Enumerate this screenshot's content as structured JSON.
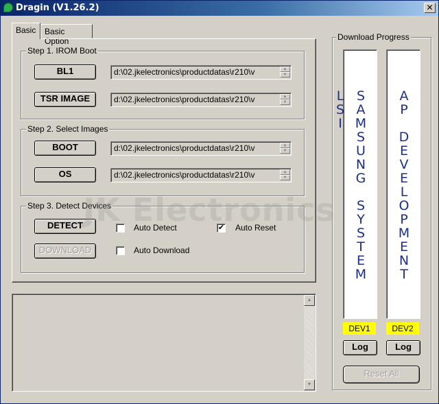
{
  "window": {
    "title": "Dragin (V1.26.2)",
    "close_glyph": "✕"
  },
  "tabs": [
    {
      "label": "Basic"
    },
    {
      "label": "Basic Option"
    }
  ],
  "step1": {
    "label": "Step 1. IROM Boot",
    "bl1_button": "BL1",
    "bl1_path": "d:\\02.jkelectronics\\productdatas\\r210\\v",
    "tsr_button": "TSR IMAGE",
    "tsr_path": "d:\\02.jkelectronics\\productdatas\\r210\\v"
  },
  "step2": {
    "label": "Step 2. Select Images",
    "boot_button": "BOOT",
    "boot_path": "d:\\02.jkelectronics\\productdatas\\r210\\v",
    "os_button": "OS",
    "os_path": "d:\\02.jkelectronics\\productdatas\\r210\\v"
  },
  "step3": {
    "label": "Step 3. Detect Devices",
    "detect_button": "DETECT",
    "download_button": "DOWNLOAD",
    "auto_detect_label": "Auto Detect",
    "auto_detect_checked": false,
    "auto_reset_label": "Auto Reset",
    "auto_reset_checked": true,
    "auto_download_label": "Auto Download",
    "auto_download_checked": false,
    "check_glyph": "✔"
  },
  "watermark": "JK Electronics",
  "download_progress": {
    "label": "Download Progress",
    "dev1_text": "SAMSUNG SYSTEM LSI",
    "dev2_text": "AP DEVELOPMENT",
    "dev1_label": "DEV1",
    "dev2_label": "DEV2",
    "log_label": "Log",
    "reset_all_label": "Reset All"
  },
  "icons": {
    "spin_up": "▲",
    "spin_down": "▼",
    "scroll_up": "▲",
    "scroll_down": "▼"
  }
}
